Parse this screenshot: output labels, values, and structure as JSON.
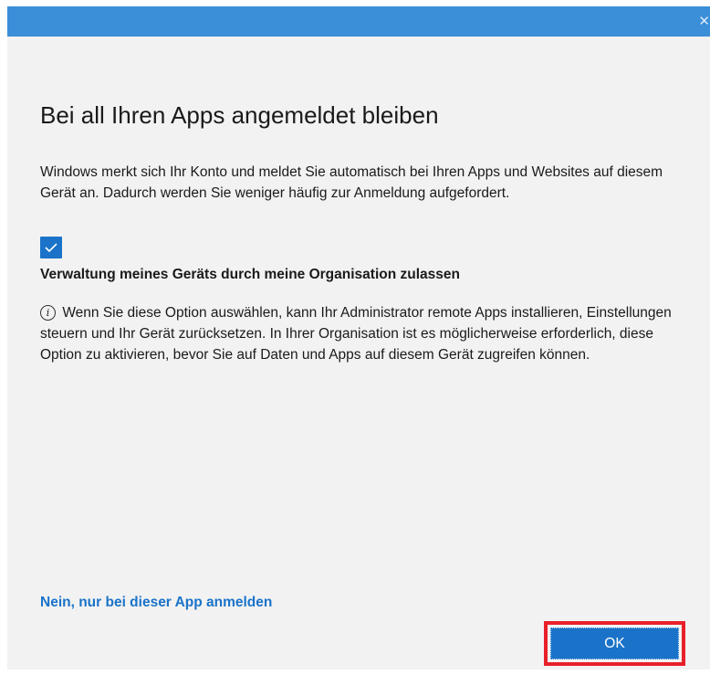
{
  "dialog": {
    "close_glyph": "✕",
    "title": "Bei all Ihren Apps angemeldet bleiben",
    "description": "Windows merkt sich Ihr Konto und meldet Sie automatisch bei Ihren Apps und Websites auf diesem Gerät an. Dadurch werden Sie weniger häufig zur Anmeldung aufgefordert.",
    "checkbox": {
      "checked": true,
      "label": "Verwaltung meines Geräts durch meine Organisation zulassen"
    },
    "info_text": "Wenn Sie diese Option auswählen, kann Ihr Administrator remote Apps installieren, Einstellungen steuern und Ihr Gerät zurücksetzen. In Ihrer Organisation ist es möglicherweise erforderlich, diese Option zu aktivieren, bevor Sie auf Daten und Apps auf diesem Gerät zugreifen können.",
    "info_icon_glyph": "i",
    "link_label": "Nein, nur bei dieser App anmelden",
    "ok_label": "OK"
  },
  "colors": {
    "titlebar": "#3b8fd9",
    "accent": "#1a73c9",
    "highlight": "#e8202a",
    "background": "#f2f2f2"
  }
}
